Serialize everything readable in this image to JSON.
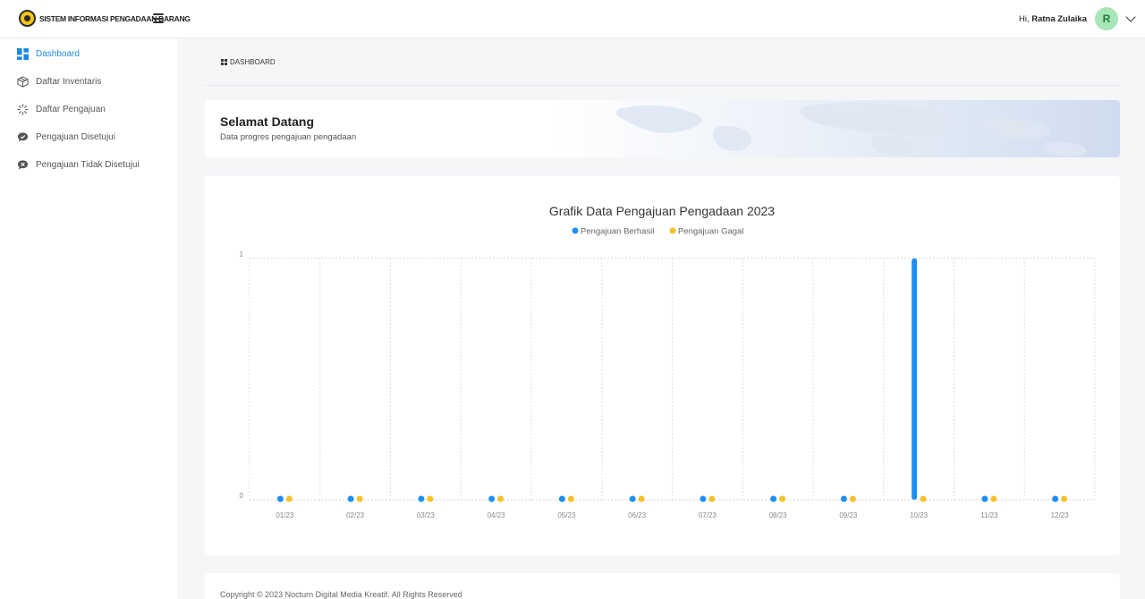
{
  "header": {
    "app_title": "SISTEM INFORMASI PENGADAAN BARANG",
    "greeting": "Hi,",
    "user_name": "Ratna Zulaika",
    "avatar_initial": "R"
  },
  "sidebar": {
    "items": [
      {
        "label": "Dashboard",
        "icon": "dashboard-icon",
        "active": true
      },
      {
        "label": "Daftar Inventaris",
        "icon": "box-icon",
        "active": false
      },
      {
        "label": "Daftar Pengajuan",
        "icon": "loader-icon",
        "active": false
      },
      {
        "label": "Pengajuan Disetujui",
        "icon": "chat-check-icon",
        "active": false
      },
      {
        "label": "Pengajuan Tidak Disetujui",
        "icon": "chat-x-icon",
        "active": false
      }
    ]
  },
  "breadcrumb": {
    "label": "DASHBOARD"
  },
  "welcome": {
    "title": "Selamat Datang",
    "subtitle": "Data progres pengajuan pengadaan"
  },
  "colors": {
    "accent": "#1e88e5",
    "series_berhasil": "#1e8ff5",
    "series_gagal": "#f6c12a"
  },
  "chart_data": {
    "type": "bar",
    "title": "Grafik Data Pengajuan Pengadaan 2023",
    "categories": [
      "01/23",
      "02/23",
      "03/23",
      "04/23",
      "05/23",
      "06/23",
      "07/23",
      "08/23",
      "09/23",
      "10/23",
      "11/23",
      "12/23"
    ],
    "series": [
      {
        "name": "Pengajuan Berhasil",
        "color": "#1e8ff5",
        "values": [
          0,
          0,
          0,
          0,
          0,
          0,
          0,
          0,
          0,
          1,
          0,
          0
        ]
      },
      {
        "name": "Pengajuan Gagal",
        "color": "#f6c12a",
        "values": [
          0,
          0,
          0,
          0,
          0,
          0,
          0,
          0,
          0,
          0,
          0,
          0
        ]
      }
    ],
    "ylim": [
      0,
      1
    ],
    "yticks": [
      "0",
      "1"
    ],
    "legend": "top-center",
    "grid": true
  },
  "footer": {
    "text": "Copyright © 2023 Nocturn Digital Media Kreatif. All Rights Reserved"
  }
}
